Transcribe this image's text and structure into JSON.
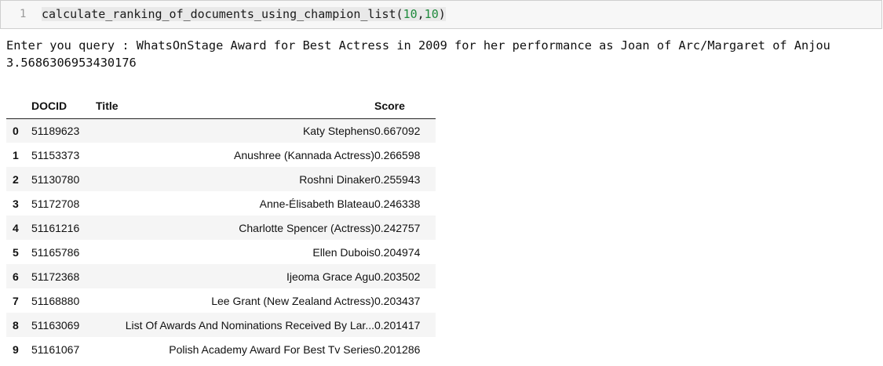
{
  "input_cell": {
    "prompt_number": "1",
    "code": {
      "fn": "calculate_ranking_of_documents_using_champion_list(",
      "arg1": "10",
      "sep": ",",
      "arg2": "10",
      "close": ")"
    }
  },
  "output": {
    "query_line": "Enter you query : WhatsOnStage Award for Best Actress in 2009 for her performance as Joan of Arc/Margaret of Anjou",
    "elapsed": "3.5686306953430176"
  },
  "table": {
    "columns": {
      "index": "",
      "docid": "DOCID",
      "title": "Title",
      "score": "Score"
    },
    "rows": [
      {
        "index": "0",
        "docid": "51189623",
        "title": "Katy Stephens",
        "score": "0.667092"
      },
      {
        "index": "1",
        "docid": "51153373",
        "title": "Anushree (Kannada Actress)",
        "score": "0.266598"
      },
      {
        "index": "2",
        "docid": "51130780",
        "title": "Roshni Dinaker",
        "score": "0.255943"
      },
      {
        "index": "3",
        "docid": "51172708",
        "title": "Anne-Élisabeth Blateau",
        "score": "0.246338"
      },
      {
        "index": "4",
        "docid": "51161216",
        "title": "Charlotte Spencer (Actress)",
        "score": "0.242757"
      },
      {
        "index": "5",
        "docid": "51165786",
        "title": "Ellen Dubois",
        "score": "0.204974"
      },
      {
        "index": "6",
        "docid": "51172368",
        "title": "Ijeoma Grace Agu",
        "score": "0.203502"
      },
      {
        "index": "7",
        "docid": "51168880",
        "title": "Lee Grant (New Zealand Actress)",
        "score": "0.203437"
      },
      {
        "index": "8",
        "docid": "51163069",
        "title": "List Of Awards And Nominations Received By Lar...",
        "score": "0.201417"
      },
      {
        "index": "9",
        "docid": "51161067",
        "title": "Polish Academy Award For Best Tv Series",
        "score": "0.201286"
      }
    ]
  }
}
